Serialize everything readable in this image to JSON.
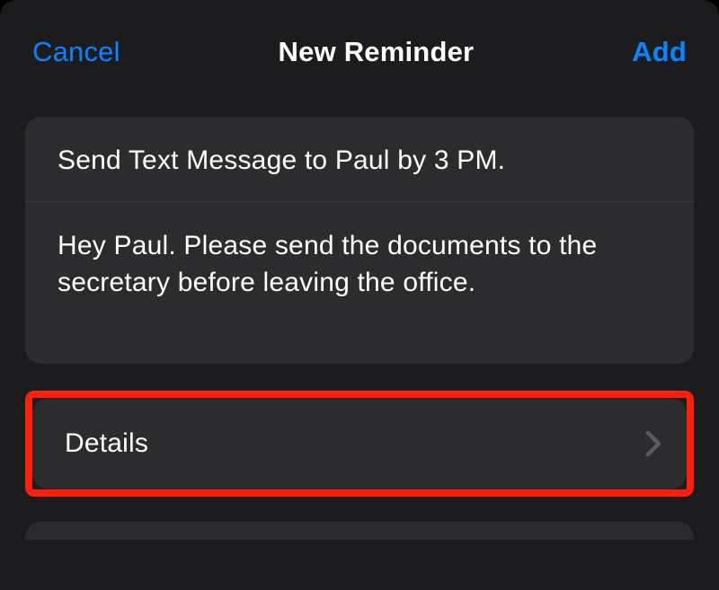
{
  "navbar": {
    "cancel": "Cancel",
    "title": "New Reminder",
    "add": "Add"
  },
  "reminder": {
    "title": "Send Text Message to Paul by 3 PM.",
    "notes": "Hey Paul. Please send the documents to the secretary before leaving the office."
  },
  "details": {
    "label": "Details"
  }
}
